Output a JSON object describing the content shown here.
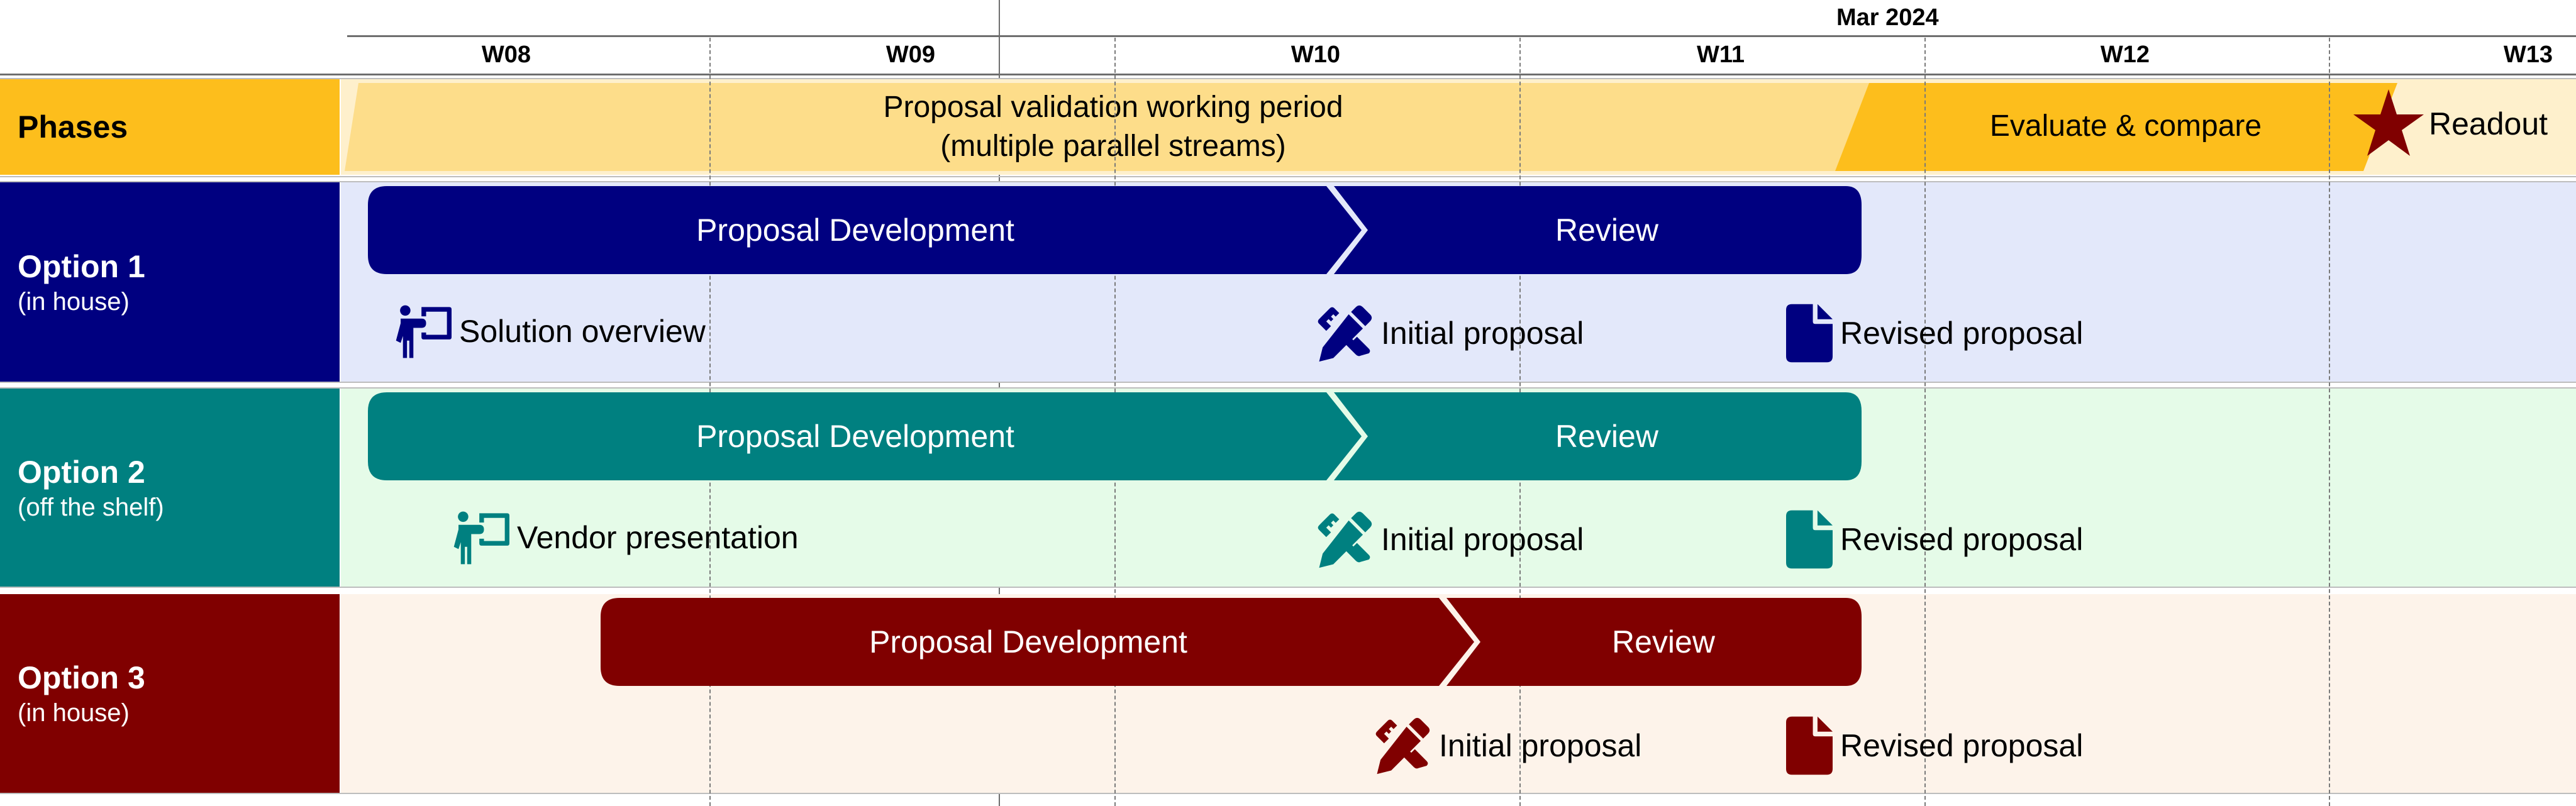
{
  "header": {
    "month": "Mar 2024",
    "weeks": [
      "W08",
      "W09",
      "W10",
      "W11",
      "W12",
      "W13"
    ]
  },
  "colors": {
    "phases": "#FDBE1C",
    "phases_light": "#FDDD8A",
    "phases_bg": "#FEF0CC",
    "option1": "#000080",
    "option1_bg": "#E3E8FA",
    "option2": "#008080",
    "option2_bg": "#E5FBE8",
    "option3": "#800000",
    "option3_bg": "#FDF3EA",
    "star": "#800000"
  },
  "phases": {
    "label": "Phases",
    "items": [
      {
        "label_line1": "Proposal validation working period",
        "label_line2": "(multiple parallel streams)"
      },
      {
        "label": "Evaluate & compare"
      }
    ],
    "milestone": {
      "label": "Readout",
      "icon": "star-icon"
    }
  },
  "options": [
    {
      "title": "Option 1",
      "subtitle": "(in house)",
      "bars": [
        {
          "label": "Proposal Development"
        },
        {
          "label": "Review"
        }
      ],
      "milestones": [
        {
          "label": "Solution overview",
          "icon": "presenter-icon"
        },
        {
          "label": "Initial proposal",
          "icon": "pencil-ruler-icon"
        },
        {
          "label": "Revised proposal",
          "icon": "document-icon"
        }
      ]
    },
    {
      "title": "Option 2",
      "subtitle": "(off the shelf)",
      "bars": [
        {
          "label": "Proposal Development"
        },
        {
          "label": "Review"
        }
      ],
      "milestones": [
        {
          "label": "Vendor presentation",
          "icon": "presenter-icon"
        },
        {
          "label": "Initial proposal",
          "icon": "pencil-ruler-icon"
        },
        {
          "label": "Revised proposal",
          "icon": "document-icon"
        }
      ]
    },
    {
      "title": "Option 3",
      "subtitle": "(in house)",
      "bars": [
        {
          "label": "Proposal Development"
        },
        {
          "label": "Review"
        }
      ],
      "milestones": [
        {
          "label": "Initial proposal",
          "icon": "pencil-ruler-icon"
        },
        {
          "label": "Revised proposal",
          "icon": "document-icon"
        }
      ]
    }
  ]
}
